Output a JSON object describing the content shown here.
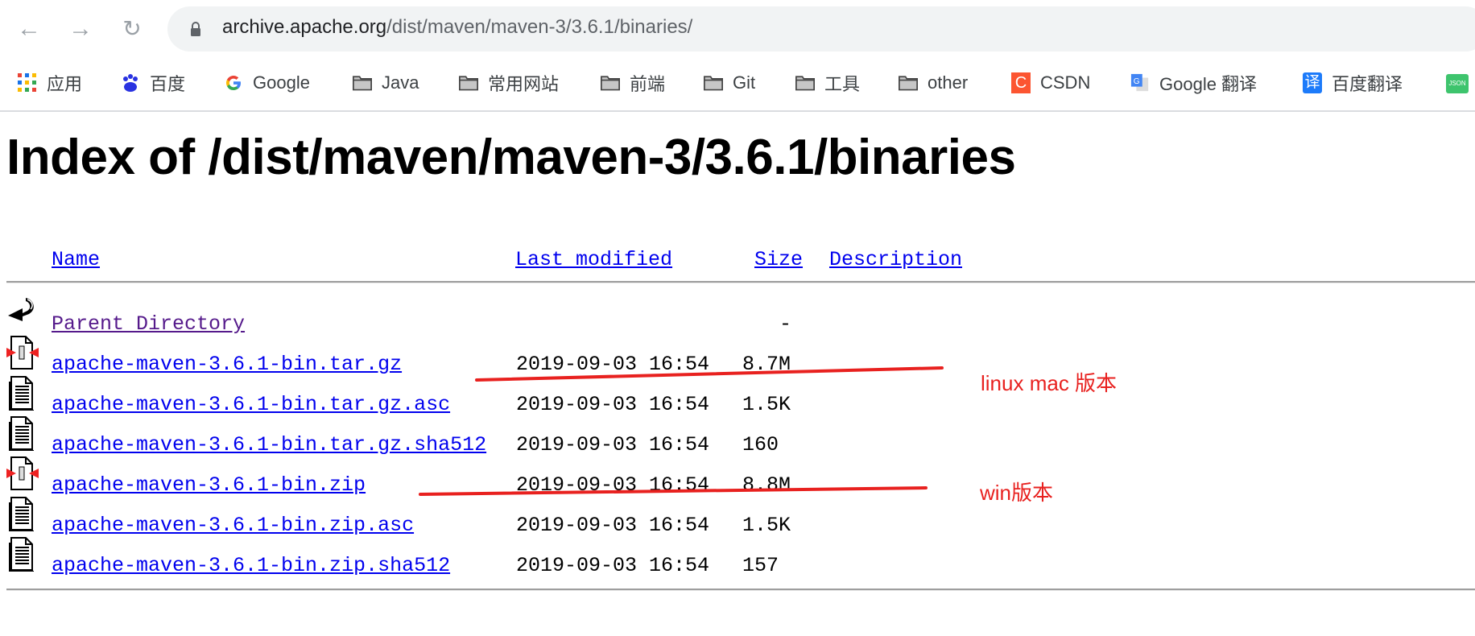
{
  "browser": {
    "url_host": "archive.apache.org",
    "url_path": "/dist/maven/maven-3/3.6.1/binaries/",
    "bookmarks": [
      {
        "label": "应用",
        "icon": "apps-grid-icon"
      },
      {
        "label": "百度",
        "icon": "baidu-paw-icon"
      },
      {
        "label": "Google",
        "icon": "google-g-icon"
      },
      {
        "label": "Java",
        "icon": "folder-icon"
      },
      {
        "label": "常用网站",
        "icon": "folder-icon"
      },
      {
        "label": "前端",
        "icon": "folder-icon"
      },
      {
        "label": "Git",
        "icon": "folder-icon"
      },
      {
        "label": "工具",
        "icon": "folder-icon"
      },
      {
        "label": "other",
        "icon": "folder-icon"
      },
      {
        "label": "CSDN",
        "icon": "csdn-icon"
      },
      {
        "label": "Google 翻译",
        "icon": "google-translate-icon"
      },
      {
        "label": "百度翻译",
        "icon": "baidu-translate-icon"
      }
    ],
    "csdn_glyph": "C",
    "baidu_translate_glyph": "译",
    "json_glyph": "JSON"
  },
  "page": {
    "title": "Index of /dist/maven/maven-3/3.6.1/binaries",
    "headers": {
      "name": "Name",
      "last_modified": "Last modified",
      "size": "Size",
      "description": "Description"
    },
    "rows": [
      {
        "name": "Parent Directory",
        "modified": "",
        "size": "-",
        "icon": "back-arrow-icon"
      },
      {
        "name": "apache-maven-3.6.1-bin.tar.gz",
        "modified": "2019-09-03 16:54",
        "size": "8.7M",
        "icon": "compressed-file-icon"
      },
      {
        "name": "apache-maven-3.6.1-bin.tar.gz.asc",
        "modified": "2019-09-03 16:54",
        "size": "1.5K",
        "icon": "text-file-icon"
      },
      {
        "name": "apache-maven-3.6.1-bin.tar.gz.sha512",
        "modified": "2019-09-03 16:54",
        "size": "160",
        "icon": "text-file-icon"
      },
      {
        "name": "apache-maven-3.6.1-bin.zip",
        "modified": "2019-09-03 16:54",
        "size": "8.8M",
        "icon": "compressed-file-icon"
      },
      {
        "name": "apache-maven-3.6.1-bin.zip.asc",
        "modified": "2019-09-03 16:54",
        "size": "1.5K",
        "icon": "text-file-icon"
      },
      {
        "name": "apache-maven-3.6.1-bin.zip.sha512",
        "modified": "2019-09-03 16:54",
        "size": "157",
        "icon": "text-file-icon"
      }
    ]
  },
  "annotations": {
    "linux_note": "linux mac 版本",
    "win_note": "win版本",
    "color": "#e8211f"
  }
}
